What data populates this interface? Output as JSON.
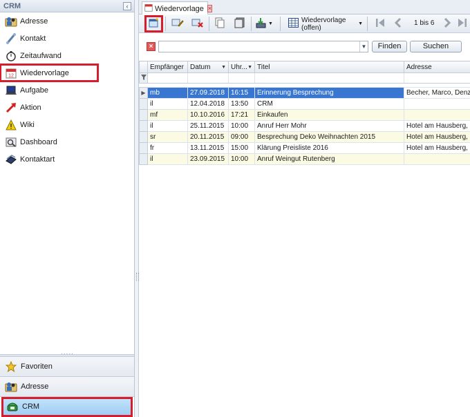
{
  "sidebar": {
    "title": "CRM",
    "collapse_icon": "chevron-left-icon",
    "items": [
      {
        "label": "Adresse",
        "icon": "address-card-icon"
      },
      {
        "label": "Kontakt",
        "icon": "phone-handset-icon"
      },
      {
        "label": "Zeitaufwand",
        "icon": "stopwatch-icon"
      },
      {
        "label": "Wiedervorlage",
        "icon": "calendar-icon",
        "active": true
      },
      {
        "label": "Aufgabe",
        "icon": "laptop-icon"
      },
      {
        "label": "Aktion",
        "icon": "arrow-icon"
      },
      {
        "label": "Wiki",
        "icon": "warning-icon"
      },
      {
        "label": "Dashboard",
        "icon": "dashboard-icon"
      },
      {
        "label": "Kontaktart",
        "icon": "card-stack-icon"
      }
    ],
    "groups": [
      {
        "label": "Favoriten",
        "icon": "star-icon"
      },
      {
        "label": "Adresse",
        "icon": "address-card-icon"
      },
      {
        "label": "CRM",
        "icon": "phone-crm-icon",
        "selected": true
      }
    ]
  },
  "tab": {
    "label": "Wiedervorlage"
  },
  "toolbar": {
    "view_label": "Wiedervorlage (offen)",
    "pager_text": "1 bis 6"
  },
  "filter": {
    "search_value": "",
    "find_label": "Finden",
    "search_label": "Suchen"
  },
  "grid": {
    "columns": [
      "Empfänger",
      "Datum",
      "Uhr...",
      "Titel",
      "Adresse"
    ],
    "rows": [
      {
        "empfaenger": "mb",
        "datum": "27.09.2018",
        "uhr": "16:15",
        "titel": "Erinnerung Besprechung",
        "adresse": "Becher, Marco, Denzlin"
      },
      {
        "empfaenger": "il",
        "datum": "12.04.2018",
        "uhr": "13:50",
        "titel": "CRM",
        "adresse": ""
      },
      {
        "empfaenger": "mf",
        "datum": "10.10.2016",
        "uhr": "17:21",
        "titel": "Einkaufen",
        "adresse": ""
      },
      {
        "empfaenger": "il",
        "datum": "25.11.2015",
        "uhr": "10:00",
        "titel": "Anruf Herr Mohr",
        "adresse": "Hotel am Hausberg, O"
      },
      {
        "empfaenger": "sr",
        "datum": "20.11.2015",
        "uhr": "09:00",
        "titel": "Besprechung Deko Weihnachten 2015",
        "adresse": "Hotel am Hausberg, O"
      },
      {
        "empfaenger": "fr",
        "datum": "13.11.2015",
        "uhr": "15:00",
        "titel": "Klärung Preisliste 2016",
        "adresse": "Hotel am Hausberg, O"
      },
      {
        "empfaenger": "il",
        "datum": "23.09.2015",
        "uhr": "10:00",
        "titel": "Anruf Weingut Rutenberg",
        "adresse": ""
      }
    ]
  },
  "colors": {
    "highlight_red": "#d61d2c",
    "selection_blue": "#3876d1",
    "row_yellow": "#fbfbe4"
  }
}
